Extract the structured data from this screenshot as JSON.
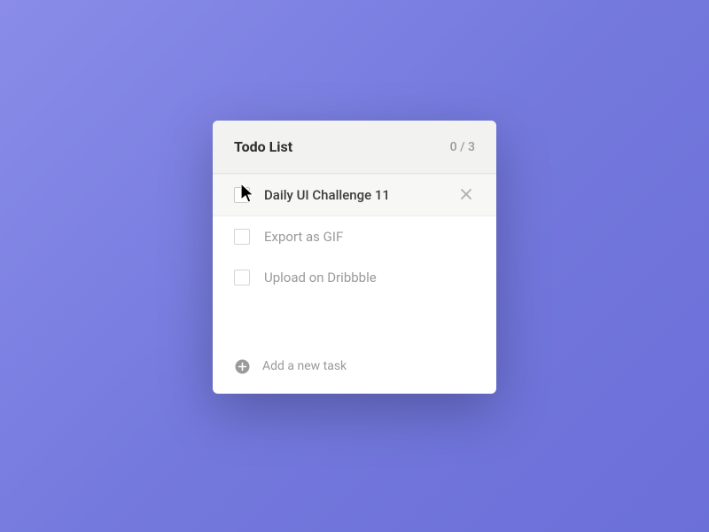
{
  "header": {
    "title": "Todo List",
    "counter": "0 / 3"
  },
  "tasks": [
    {
      "label": "Daily UI Challenge 11",
      "hover": true
    },
    {
      "label": "Export as GIF",
      "hover": false
    },
    {
      "label": "Upload on Dribbble",
      "hover": false
    }
  ],
  "addTask": {
    "label": "Add a new task"
  }
}
